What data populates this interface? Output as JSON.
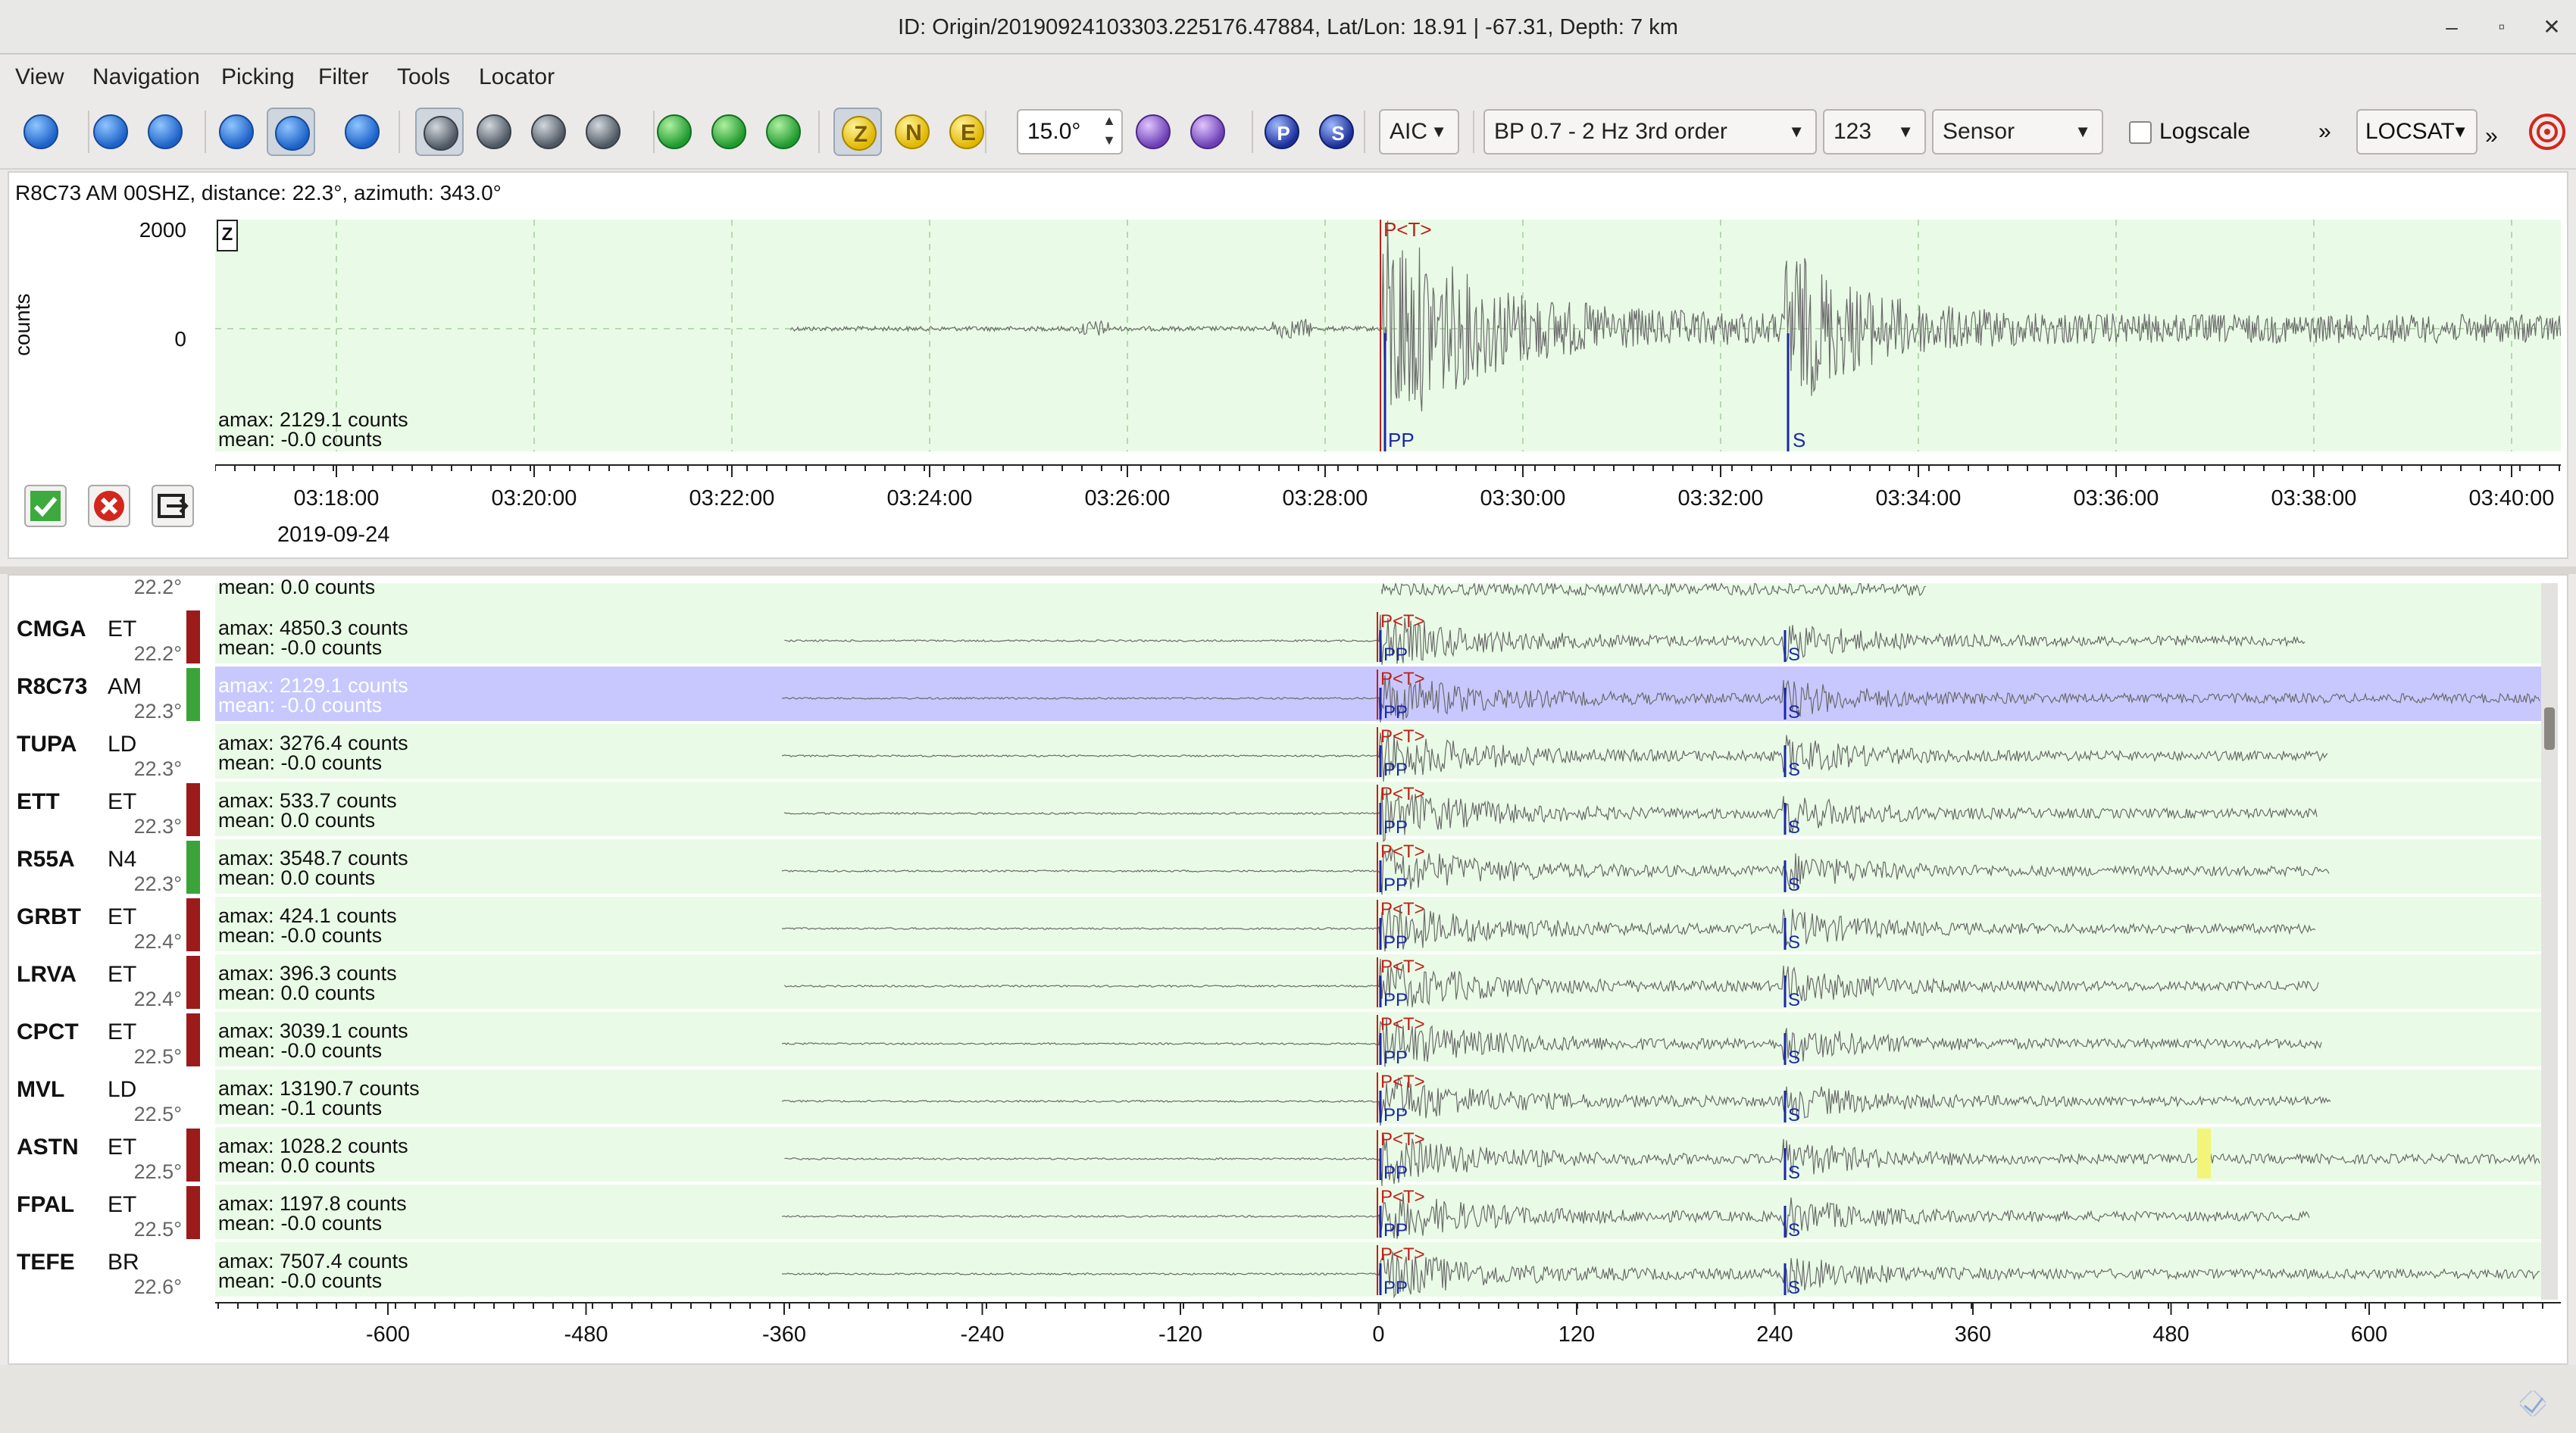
{
  "window": {
    "title": "ID: Origin/20190924103303.225176.47884, Lat/Lon: 18.91 | -67.31, Depth: 7 km",
    "controls": [
      "–",
      "▫",
      "✕"
    ]
  },
  "menu": [
    "View",
    "Navigation",
    "Picking",
    "Filter",
    "Tools",
    "Locator"
  ],
  "toolbar": {
    "icons": [
      {
        "name": "home-icon",
        "color": "blue"
      },
      {
        "name": "previous-icon",
        "color": "blue"
      },
      {
        "name": "next-icon",
        "color": "blue"
      },
      {
        "name": "zoom-out-horizontal-icon",
        "color": "blue"
      },
      {
        "name": "zoom-fit-icon",
        "color": "blue"
      },
      {
        "name": "align-icon",
        "color": "blue"
      },
      {
        "name": "sort-distance-icon",
        "color": "gray"
      },
      {
        "name": "sort-azimuth-icon",
        "color": "gray"
      },
      {
        "name": "sort-station-icon",
        "color": "gray"
      },
      {
        "name": "sort-residual-icon",
        "color": "gray"
      },
      {
        "name": "pick-record-icon",
        "color": "green"
      },
      {
        "name": "pick-replay-icon",
        "color": "green"
      },
      {
        "name": "pick-settings-icon",
        "color": "green"
      },
      {
        "name": "component-z-icon",
        "color": "yellow",
        "glyph": "Z"
      },
      {
        "name": "component-n-icon",
        "color": "yellow",
        "glyph": "N"
      },
      {
        "name": "component-e-icon",
        "color": "yellow",
        "glyph": "E"
      }
    ],
    "rotation_value": "15.0°",
    "after_spin_icons": [
      {
        "name": "rotate-left-icon",
        "color": "purple"
      },
      {
        "name": "rotate-right-icon",
        "color": "purple"
      },
      {
        "name": "phase-p-icon",
        "color": "navy",
        "glyph": "P"
      },
      {
        "name": "phase-s-icon",
        "color": "navy",
        "glyph": "S"
      }
    ],
    "picker_combo": "AIC",
    "filter_combo": "BP 0.7 - 2 Hz  3rd order",
    "number_combo": "123",
    "unit_combo": "Sensor",
    "logscale_label": "Logscale",
    "more_label": "»",
    "locator_combo": "LOCSAT",
    "more_label2": "»"
  },
  "trace_view": {
    "header": "R8C73   AM   00SHZ, distance: 22.3°, azimuth: 343.0°",
    "y_axis_label": "counts",
    "y_ticks": [
      "2000",
      "0"
    ],
    "component": "Z",
    "amax": "amax: 2129.1 counts",
    "mean": "mean: -0.0 counts",
    "time_ticks": [
      "03:18:00",
      "03:20:00",
      "03:22:00",
      "03:24:00",
      "03:26:00",
      "03:28:00",
      "03:30:00",
      "03:32:00",
      "03:34:00",
      "03:36:00",
      "03:38:00",
      "03:40:00"
    ],
    "date": "2019-09-24",
    "pick_labels": {
      "theoretical": "P<T>",
      "p": "P",
      "s": "S"
    }
  },
  "station_list": {
    "top_partial": {
      "dist": "22.2°",
      "mean": "mean: 0.0 counts"
    },
    "rows": [
      {
        "station": "CMGA",
        "network": "ET",
        "dist": "22.2°",
        "status": "red",
        "amax": "amax: 4850.3 counts",
        "mean": "mean: -0.0 counts",
        "selected": false
      },
      {
        "station": "R8C73",
        "network": "AM",
        "dist": "22.3°",
        "status": "green",
        "amax": "amax: 2129.1 counts",
        "mean": "mean: -0.0 counts",
        "selected": true
      },
      {
        "station": "TUPA",
        "network": "LD",
        "dist": "22.3°",
        "status": "none",
        "amax": "amax: 3276.4 counts",
        "mean": "mean: -0.0 counts",
        "selected": false
      },
      {
        "station": "ETT",
        "network": "ET",
        "dist": "22.3°",
        "status": "red",
        "amax": "amax: 533.7 counts",
        "mean": "mean: 0.0 counts",
        "selected": false
      },
      {
        "station": "R55A",
        "network": "N4",
        "dist": "22.3°",
        "status": "green",
        "amax": "amax: 3548.7 counts",
        "mean": "mean: 0.0 counts",
        "selected": false
      },
      {
        "station": "GRBT",
        "network": "ET",
        "dist": "22.4°",
        "status": "red",
        "amax": "amax: 424.1 counts",
        "mean": "mean: -0.0 counts",
        "selected": false
      },
      {
        "station": "LRVA",
        "network": "ET",
        "dist": "22.4°",
        "status": "red",
        "amax": "amax: 396.3 counts",
        "mean": "mean: 0.0 counts",
        "selected": false
      },
      {
        "station": "CPCT",
        "network": "ET",
        "dist": "22.5°",
        "status": "red",
        "amax": "amax: 3039.1 counts",
        "mean": "mean: -0.0 counts",
        "selected": false
      },
      {
        "station": "MVL",
        "network": "LD",
        "dist": "22.5°",
        "status": "none",
        "amax": "amax: 13190.7 counts",
        "mean": "mean: -0.1 counts",
        "selected": false
      },
      {
        "station": "ASTN",
        "network": "ET",
        "dist": "22.5°",
        "status": "red",
        "amax": "amax: 1028.2 counts",
        "mean": "mean: 0.0 counts",
        "selected": false
      },
      {
        "station": "FPAL",
        "network": "ET",
        "dist": "22.5°",
        "status": "red",
        "amax": "amax: 1197.8 counts",
        "mean": "mean: -0.0 counts",
        "selected": false
      },
      {
        "station": "TEFE",
        "network": "BR",
        "dist": "22.6°",
        "status": "none",
        "amax": "amax: 7507.4 counts",
        "mean": "mean: -0.0 counts",
        "selected": false
      }
    ],
    "relative_ticks": [
      "-600",
      "-480",
      "-360",
      "-240",
      "-120",
      "0",
      "120",
      "240",
      "360",
      "480",
      "600"
    ]
  },
  "colors": {
    "plot_bg": "#e9fbe6",
    "selected_row": "#c8c8ff",
    "trace": "#6b6b6b",
    "theoretical_pick": "#c0201a",
    "pick": "#1a27a8",
    "status_red": "#9b1b1b",
    "status_green": "#3aa43a"
  }
}
